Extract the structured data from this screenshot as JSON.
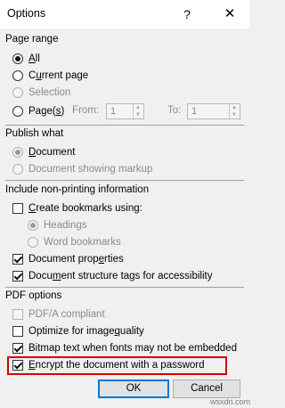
{
  "window": {
    "title": "Options",
    "help_glyph": "?",
    "close_glyph": "✕"
  },
  "page_range": {
    "header": "Page range",
    "all": {
      "pre": "",
      "u": "A",
      "post": "ll",
      "checked": true
    },
    "current_page": {
      "pre": "C",
      "u": "u",
      "post": "rrent page",
      "checked": false
    },
    "selection": {
      "label": "Selection",
      "checked": false,
      "disabled": true
    },
    "pages": {
      "pre": "Page(",
      "u": "s",
      "post": ")",
      "checked": false
    },
    "from": {
      "label": "From:",
      "value": "1"
    },
    "to": {
      "label": "To:",
      "value": "1"
    }
  },
  "publish_what": {
    "header": "Publish what",
    "document": {
      "pre": "",
      "u": "D",
      "post": "ocument",
      "checked": true,
      "disabled": true
    },
    "markup": {
      "label": "Document showing markup",
      "checked": false,
      "disabled": true
    }
  },
  "non_printing": {
    "header": "Include non-printing information",
    "create_bookmarks": {
      "pre": "",
      "u": "C",
      "post": "reate bookmarks using:",
      "checked": false
    },
    "headings": {
      "label": "Headings",
      "checked": true,
      "disabled": true
    },
    "word_bookmarks": {
      "label": "Word bookmarks",
      "checked": false,
      "disabled": true
    },
    "doc_properties": {
      "pre": "Document prop",
      "u": "e",
      "post": "rties",
      "checked": true
    },
    "structure_tags": {
      "pre": "Docu",
      "u": "m",
      "post": "ent structure tags for accessibility",
      "checked": true
    }
  },
  "pdf_options": {
    "header": "PDF options",
    "pdfa": {
      "label": "PDF/A compliant",
      "checked": false,
      "disabled": true
    },
    "optimize": {
      "pre": "Optimize for image ",
      "u": "q",
      "post": "uality",
      "checked": false
    },
    "bitmap_text": {
      "label": "Bitmap text when fonts may not be embedded",
      "checked": true
    },
    "encrypt": {
      "pre": "",
      "u": "E",
      "post": "ncrypt the document with a password",
      "checked": true
    }
  },
  "buttons": {
    "ok": "OK",
    "cancel": "Cancel"
  },
  "watermark": "wsxdn.com",
  "colors": {
    "highlight": "#d40000",
    "focus": "#0078d7"
  }
}
